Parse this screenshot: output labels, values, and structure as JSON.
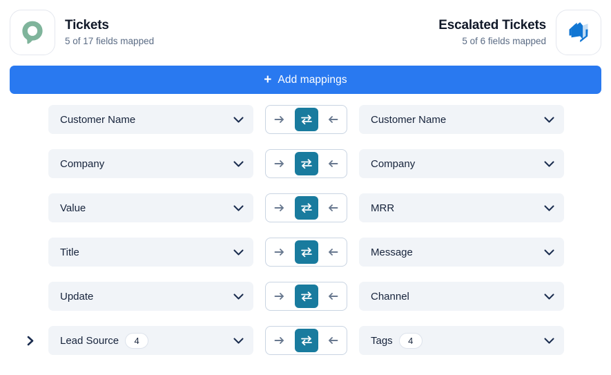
{
  "header": {
    "source": {
      "logo_icon": "intercom-logo-icon",
      "title": "Tickets",
      "subtitle": "5 of 17 fields mapped"
    },
    "target": {
      "logo_icon": "azure-devops-logo-icon",
      "title": "Escalated Tickets",
      "subtitle": "5 of 6 fields mapped"
    }
  },
  "toolbar": {
    "add_mappings_label": "Add mappings",
    "add_icon": "plus-icon"
  },
  "colors": {
    "accent_blue": "#2979f0",
    "selected_teal": "#197b9e",
    "field_bg": "#f1f4f8",
    "text_primary": "#16233b",
    "text_muted": "#5a6b84",
    "border": "#c9d4e2"
  },
  "direction_options": [
    {
      "value": "right",
      "icon": "arrow-right-icon",
      "title": "Source to target"
    },
    {
      "value": "both",
      "icon": "bidirectional-arrows-icon",
      "title": "Bidirectional"
    },
    {
      "value": "left",
      "icon": "arrow-left-icon",
      "title": "Target to source"
    }
  ],
  "mappings": [
    {
      "expandable": false,
      "source": {
        "label": "Customer Name",
        "badge": null
      },
      "direction": "both",
      "target": {
        "label": "Customer Name",
        "badge": null
      }
    },
    {
      "expandable": false,
      "source": {
        "label": "Company",
        "badge": null
      },
      "direction": "both",
      "target": {
        "label": "Company",
        "badge": null
      }
    },
    {
      "expandable": false,
      "source": {
        "label": "Value",
        "badge": null
      },
      "direction": "both",
      "target": {
        "label": "MRR",
        "badge": null
      }
    },
    {
      "expandable": false,
      "source": {
        "label": "Title",
        "badge": null
      },
      "direction": "both",
      "target": {
        "label": "Message",
        "badge": null
      }
    },
    {
      "expandable": false,
      "source": {
        "label": "Update",
        "badge": null
      },
      "direction": "both",
      "target": {
        "label": "Channel",
        "badge": null
      }
    },
    {
      "expandable": true,
      "source": {
        "label": "Lead Source",
        "badge": "4"
      },
      "direction": "both",
      "target": {
        "label": "Tags",
        "badge": "4"
      }
    }
  ]
}
